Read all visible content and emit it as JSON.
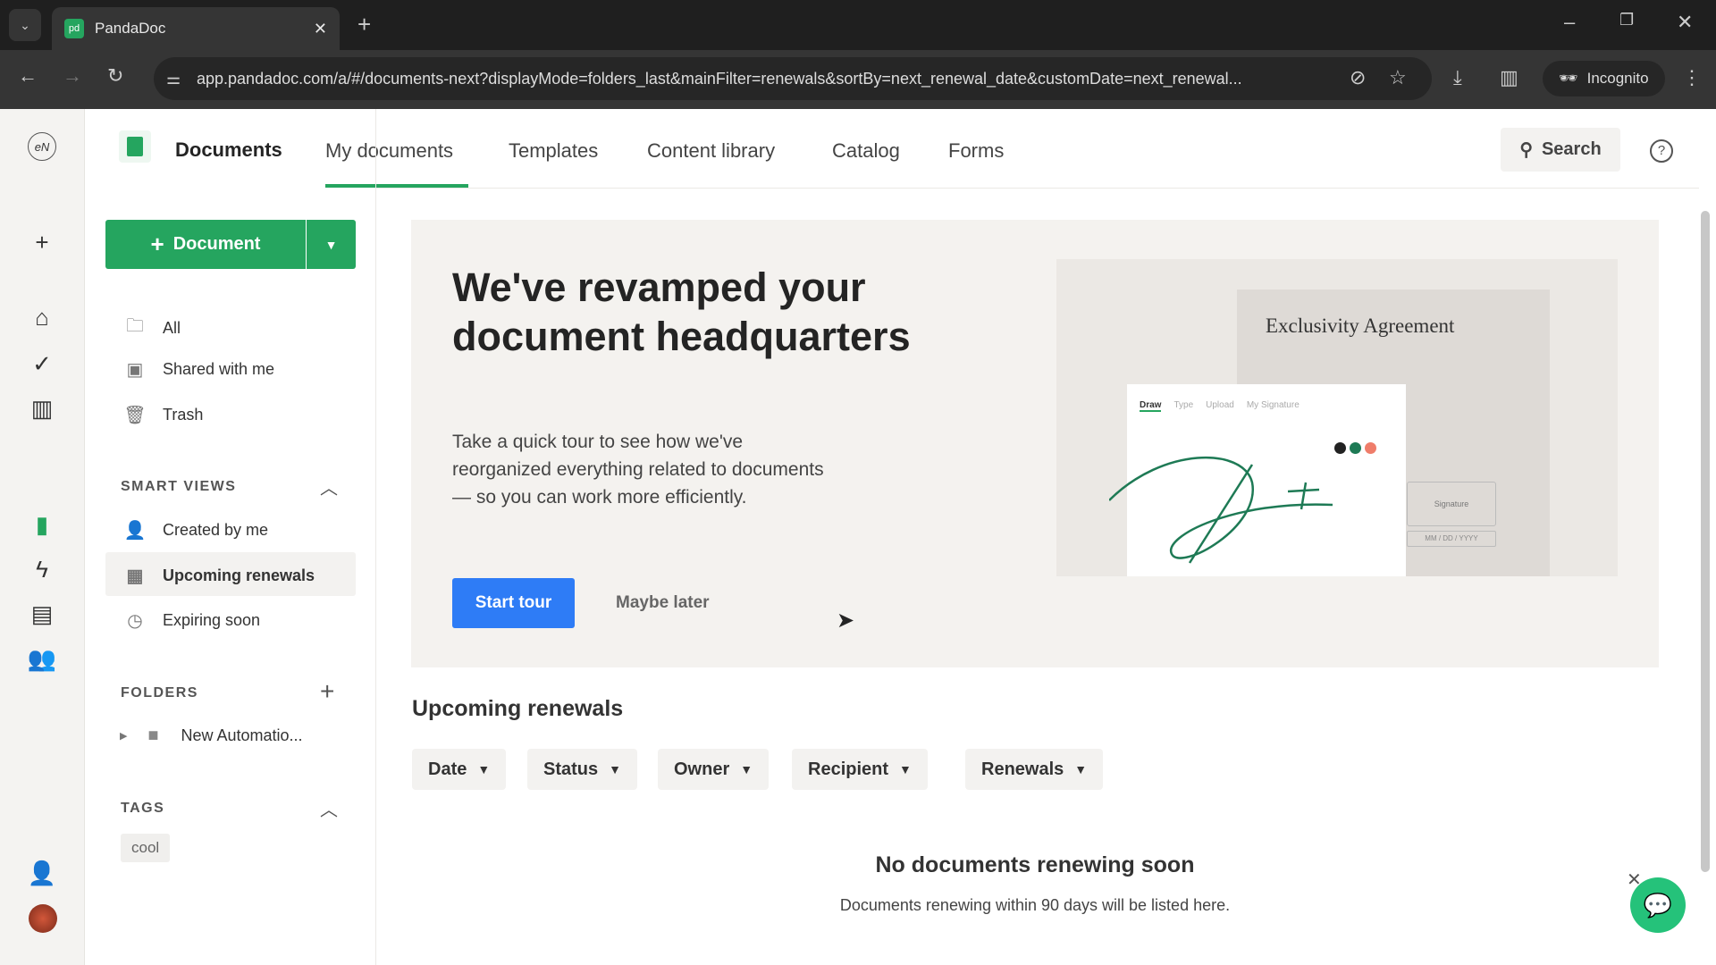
{
  "browser": {
    "tab_title": "PandaDoc",
    "tab_favicon": "pd",
    "url": "app.pandadoc.com/a/#/documents-next?displayMode=folders_last&mainFilter=renewals&sortBy=next_renewal_date&customDate=next_renewal...",
    "incognito_label": "Incognito"
  },
  "header": {
    "title": "Documents",
    "tabs": [
      "My documents",
      "Templates",
      "Content library",
      "Catalog",
      "Forms"
    ],
    "active_tab": "My documents",
    "search_label": "Search"
  },
  "sidebar": {
    "new_document_label": "Document",
    "items": [
      "All",
      "Shared with me",
      "Trash"
    ],
    "smart_views_title": "SMART VIEWS",
    "smart_views": [
      "Created by me",
      "Upcoming renewals",
      "Expiring soon"
    ],
    "active_view": "Upcoming renewals",
    "folders_title": "FOLDERS",
    "folders": [
      "New Automatio..."
    ],
    "tags_title": "TAGS",
    "tags": [
      "cool"
    ]
  },
  "banner": {
    "heading": "We've revamped your document headquarters",
    "body": "Take a quick tour to see how we've reorganized everything related to documents — so you can work more efficiently.",
    "start_label": "Start tour",
    "later_label": "Maybe later",
    "illustration": {
      "doc_title": "Exclusivity Agreement",
      "tabs": [
        "Draw",
        "Type",
        "Upload",
        "My Signature"
      ],
      "signature_field": "Signature",
      "date_field": "MM / DD / YYYY"
    }
  },
  "renewals": {
    "title": "Upcoming renewals",
    "filters": [
      "Date",
      "Status",
      "Owner",
      "Recipient",
      "Renewals"
    ],
    "empty_title": "No documents renewing soon",
    "empty_body": "Documents renewing within 90 days will be listed here."
  },
  "colors": {
    "brand_green": "#25a55f",
    "primary_blue": "#2e7cf6"
  }
}
